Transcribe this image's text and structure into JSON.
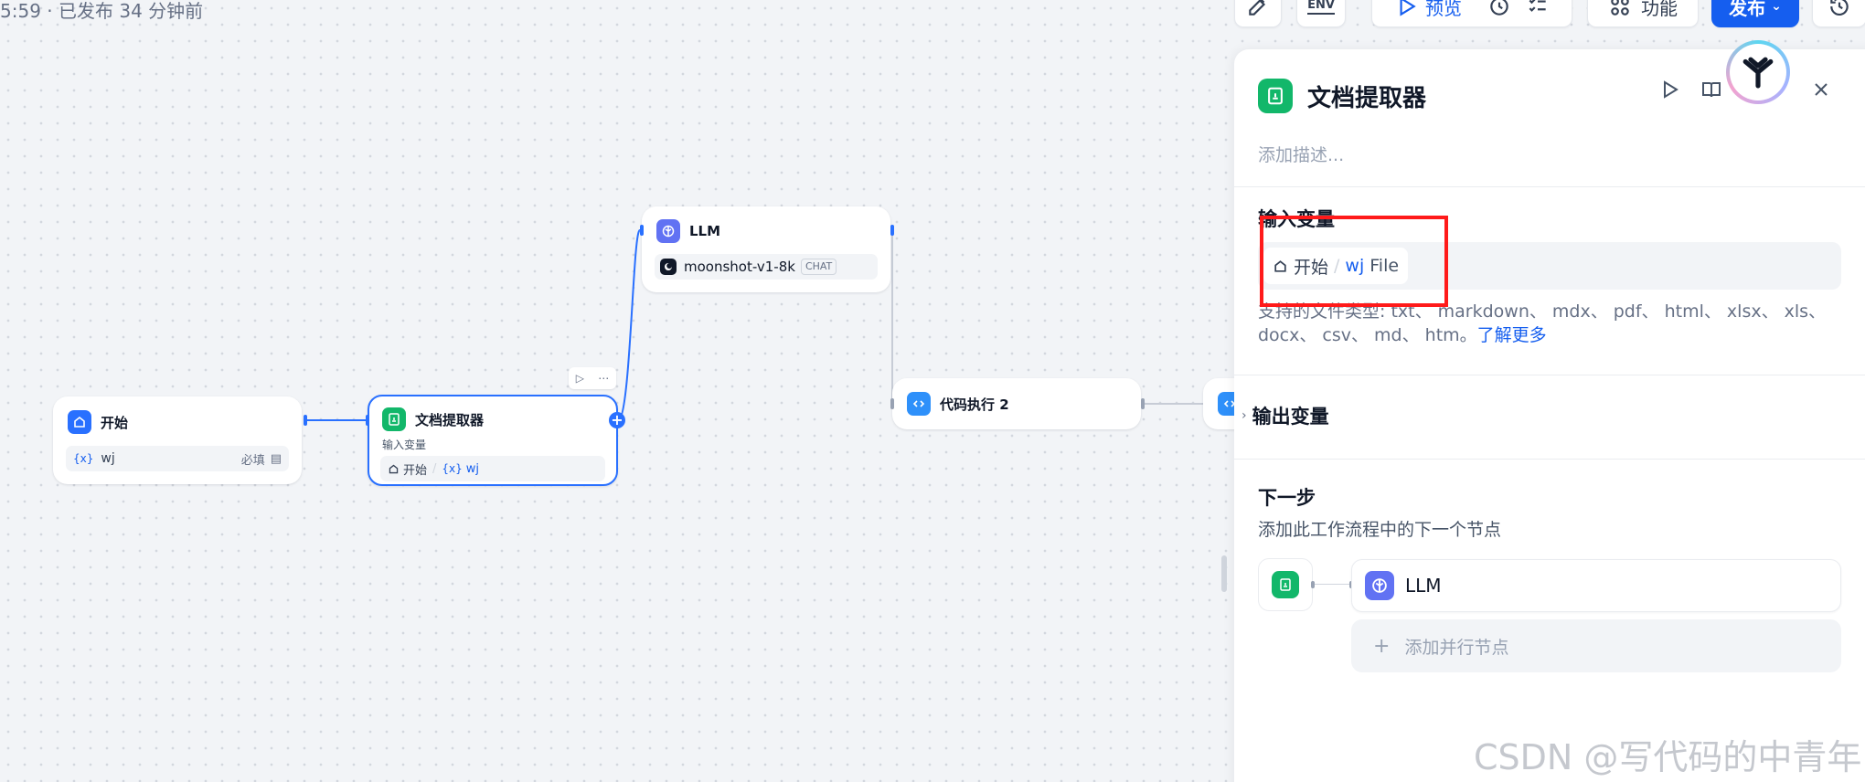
{
  "app": {
    "status_text": "5:59 · 已发布 34 分钟前"
  },
  "toolbar": {
    "env_label": "ENV",
    "preview_label": "预览",
    "features_label": "功能",
    "publish_label": "发布"
  },
  "canvas": {
    "nodes": {
      "start": {
        "title": "开始",
        "var_name": "wj",
        "var_required": "必填"
      },
      "doc_extractor": {
        "title": "文档提取器",
        "input_label": "输入变量",
        "source_node": "开始",
        "var_name": "wj"
      },
      "llm": {
        "title": "LLM",
        "model_name": "moonshot-v1-8k",
        "model_badge": "CHAT"
      },
      "code": {
        "title": "代码执行 2"
      }
    }
  },
  "panel": {
    "title": "文档提取器",
    "description_placeholder": "添加描述...",
    "input_section_title": "输入变量",
    "input_source": "开始",
    "input_var": "wj",
    "input_type": "File",
    "filetypes_text": "支持的文件类型: txt、 markdown、 mdx、 pdf、 html、 xlsx、 xls、 docx、 csv、 md、 htm。",
    "learn_more": "了解更多",
    "output_section_title": "输出变量",
    "next_step_title": "下一步",
    "next_step_desc": "添加此工作流程中的下一个节点",
    "next_node_label": "LLM",
    "add_parallel_label": "添加并行节点"
  },
  "watermark": "CSDN @写代码的中青年",
  "colors": {
    "accent": "#155eef",
    "highlight": "#ff1a1a",
    "doc_node": "#12b76a",
    "llm_node": "#6172f3",
    "start_node": "#2970ff"
  }
}
